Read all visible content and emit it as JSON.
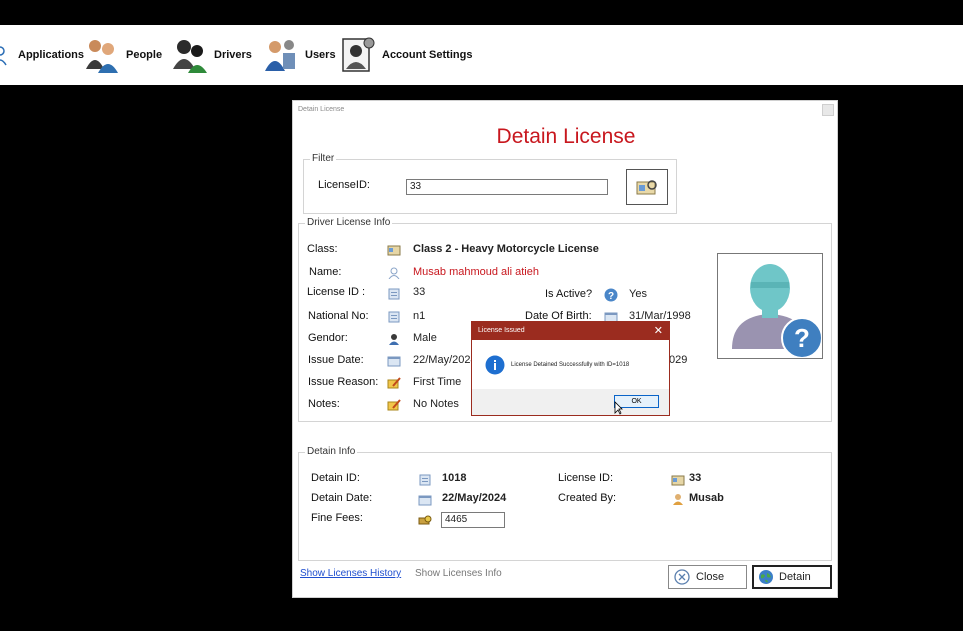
{
  "menu": [
    {
      "label": "Applications",
      "icon": "application-icon"
    },
    {
      "label": "People",
      "icon": "people-icon"
    },
    {
      "label": "Drivers",
      "icon": "drivers-icon"
    },
    {
      "label": "Users",
      "icon": "users-icon"
    },
    {
      "label": "Account Settings",
      "icon": "account-settings-icon"
    }
  ],
  "dialog": {
    "title": "Detain License",
    "heading": "Detain License"
  },
  "filter": {
    "group_title": "Filter",
    "label": "LicenseID:",
    "value": "33"
  },
  "license_info": {
    "group_title": "Driver License Info",
    "class_label": "Class:",
    "class_value": "Class 2 - Heavy Motorcycle License",
    "name_label": "Name:",
    "name_value": "Musab mahmoud ali atieh",
    "license_id_label": "License ID :",
    "license_id_value": "33",
    "is_active_label": "Is Active?",
    "is_active_value": "Yes",
    "national_no_label": "National No:",
    "national_no_value": "n1",
    "dob_label": "Date Of Birth:",
    "dob_value": "31/Mar/1998",
    "gender_label": "Gendor:",
    "gender_value": "Male",
    "issue_date_label": "Issue Date:",
    "issue_date_value": "22/May/2024",
    "expiry_partial": "029",
    "issue_reason_label": "Issue Reason:",
    "issue_reason_value": "First Time",
    "notes_label": "Notes:",
    "notes_value": "No Notes"
  },
  "detain_info": {
    "group_title": "Detain Info",
    "detain_id_label": "Detain ID:",
    "detain_id_value": "1018",
    "license_id_label": "License ID:",
    "license_id_value": "33",
    "detain_date_label": "Detain Date:",
    "detain_date_value": "22/May/2024",
    "created_by_label": "Created By:",
    "created_by_value": "Musab",
    "fine_fees_label": "Fine Fees:",
    "fine_fees_value": "4465"
  },
  "footer": {
    "history_link": "Show Licenses History",
    "info_link": "Show Licenses Info",
    "close_label": "Close",
    "detain_label": "Detain"
  },
  "message_box": {
    "title": "License Issued",
    "text": "License Detained Successfully with ID=1018",
    "ok_label": "OK"
  },
  "colors": {
    "accent_red": "#c8171e",
    "msgbox_border": "#9b2c1f",
    "link_blue": "#1f4fcf"
  }
}
